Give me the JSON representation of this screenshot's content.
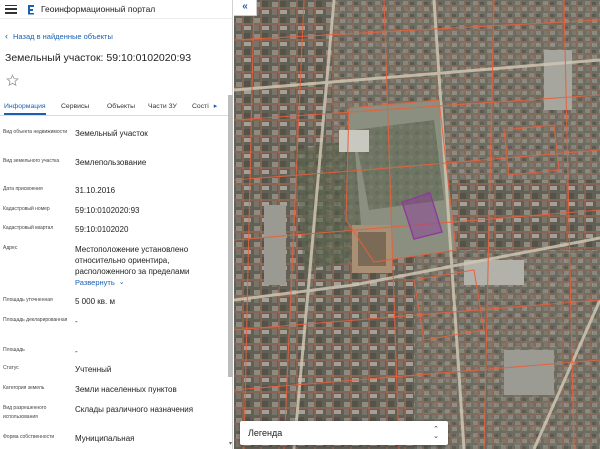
{
  "header": {
    "title": "Геоинформационный портал"
  },
  "nav": {
    "back_label": "Назад в найденные объекты"
  },
  "parcel": {
    "title": "Земельный участок: 59:10:0102020:93"
  },
  "tabs": [
    {
      "label": "Информация",
      "active": true
    },
    {
      "label": "Сервисы",
      "active": false
    },
    {
      "label": "Объекты",
      "active": false
    },
    {
      "label": "Части ЗУ",
      "active": false
    },
    {
      "label": "Сості",
      "active": false
    }
  ],
  "attributes": [
    {
      "label": "Вид объекта недвижимости",
      "value": "Земельный участок"
    },
    {
      "label": "Вид земельного участка",
      "value": "Землепользование"
    },
    {
      "label": "Дата присвоения",
      "value": "31.10.2016"
    },
    {
      "label": "Кадастровый номер",
      "value": "59:10:0102020:93"
    },
    {
      "label": "Кадастровый квартал",
      "value": "59:10:0102020"
    },
    {
      "label": "Адрес",
      "value": "Местоположение установлено относительно ориентира, расположенного за пределами",
      "expand_label": "Развернуть"
    },
    {
      "label": "Площадь уточненная",
      "value": "5 000 кв. м"
    },
    {
      "label": "Площадь декларированная",
      "value": "-"
    },
    {
      "label": "Площадь",
      "value": "-"
    },
    {
      "label": "Статус",
      "value": "Учтенный"
    },
    {
      "label": "Категория земель",
      "value": "Земли населенных пунктов"
    },
    {
      "label": "Вид разрешенного использования",
      "value": "Склады различного назначения"
    },
    {
      "label": "Форма собственности",
      "value": "Муниципальная"
    }
  ],
  "map": {
    "collapse_glyph": "«",
    "legend_label": "Легенда",
    "legend_glyph": "⌃⌄",
    "parcel_color": "#8e3a9c",
    "boundary_color": "#e8603c"
  }
}
